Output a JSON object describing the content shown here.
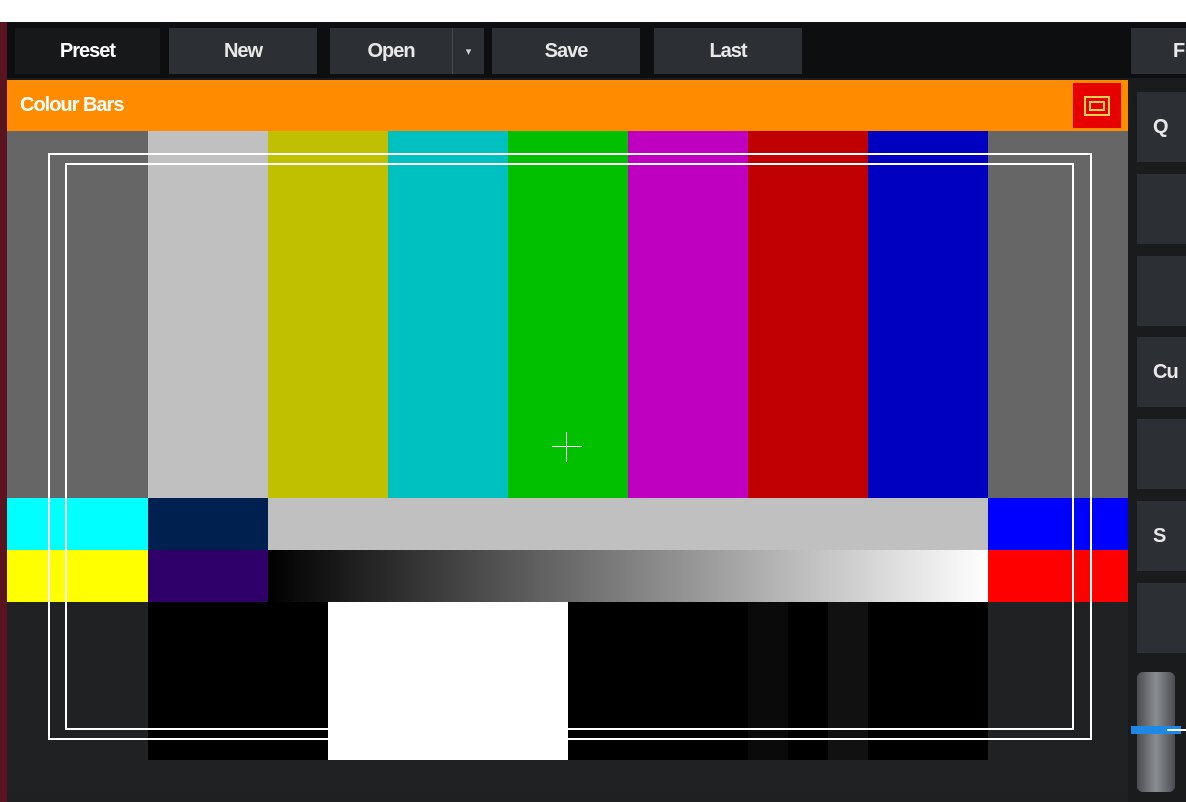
{
  "toolbar": {
    "preset_label": "Preset",
    "new_label": "New",
    "open_label": "Open",
    "open_dropdown_glyph": "▾",
    "save_label": "Save",
    "last_label": "Last",
    "right_label_partial": "F"
  },
  "input": {
    "title": "Colour Bars",
    "title_bar_color": "#ff8c00",
    "fullscreen_button_icon": "fullscreen-icon",
    "fullscreen_button_color": "#e60000"
  },
  "test_pattern": {
    "top_bars": [
      "#c0c0c0",
      "#c0c000",
      "#00c0c0",
      "#00c000",
      "#c000c0",
      "#c00000",
      "#0000c0"
    ],
    "mid_row": [
      "#00ffff",
      "#00204f",
      "#c0c0c0",
      "#0000ff"
    ],
    "low_row": [
      "#ffff00",
      "#30006a",
      "gradient-black-to-white",
      "#ff0000"
    ],
    "pluge_white": "#ffffff",
    "side_gray": "#666666"
  },
  "right_panel": {
    "buttons": [
      "Q",
      "",
      "",
      "Cu",
      "",
      "S",
      ""
    ],
    "transition_slider_level": 0.5
  }
}
